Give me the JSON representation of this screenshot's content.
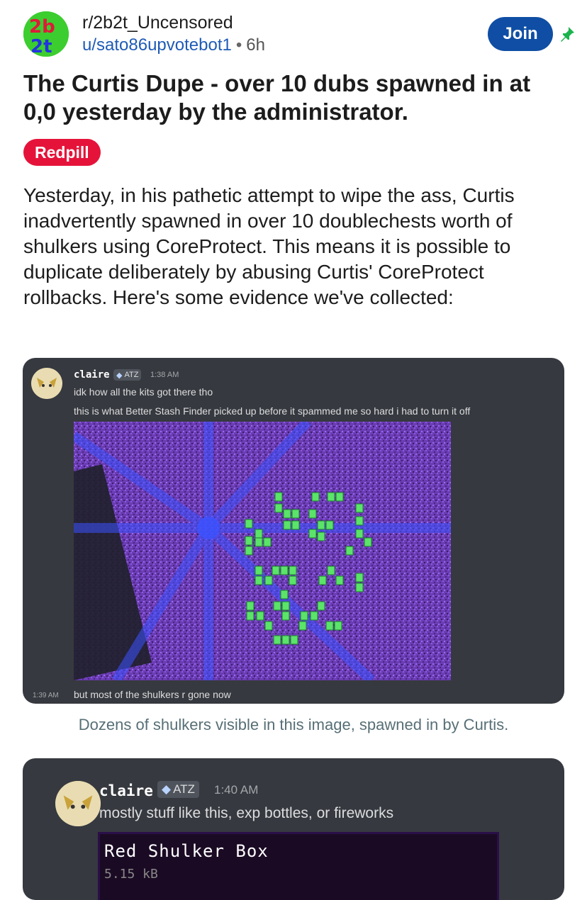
{
  "post": {
    "subreddit": "r/2b2t_Uncensored",
    "author": "u/sato86upvotebot1",
    "separator": "•",
    "time": "6h",
    "join_label": "Join",
    "title": "The Curtis Dupe - over 10 dubs spawned in at 0,0 yesterday by the administrator.",
    "flair": "Redpill",
    "body": "Yesterday, in his pathetic attempt to wipe the ass, Curtis inadvertently spawned in over 10 doublechests worth of shulkers using CoreProtect. This means it is possible to duplicate deliberately by abusing Curtis' CoreProtect rollbacks. Here's some evidence we've collected:",
    "caption": "Dozens of shulkers visible in this image, spawned in by Curtis."
  },
  "image1": {
    "username": "claire",
    "badge": "ATZ",
    "time": "1:38 AM",
    "messages": [
      "idk how all the kits got there tho",
      "this is what Better Stash Finder picked up before it spammed me so hard i had to turn it off"
    ],
    "followup_time": "1:39 AM",
    "followup": "but most of the shulkers r gone now"
  },
  "image2": {
    "username": "claire",
    "badge": "ATZ",
    "time": "1:40 AM",
    "message": "mostly stuff like this, exp bottles, or fireworks",
    "tooltip_title": "Red Shulker Box",
    "tooltip_size": "5.15 kB"
  },
  "colors": {
    "join": "#0f4ea4",
    "flair": "#e5133a",
    "link": "#1f5bb6",
    "discord_bg": "#36393f"
  }
}
